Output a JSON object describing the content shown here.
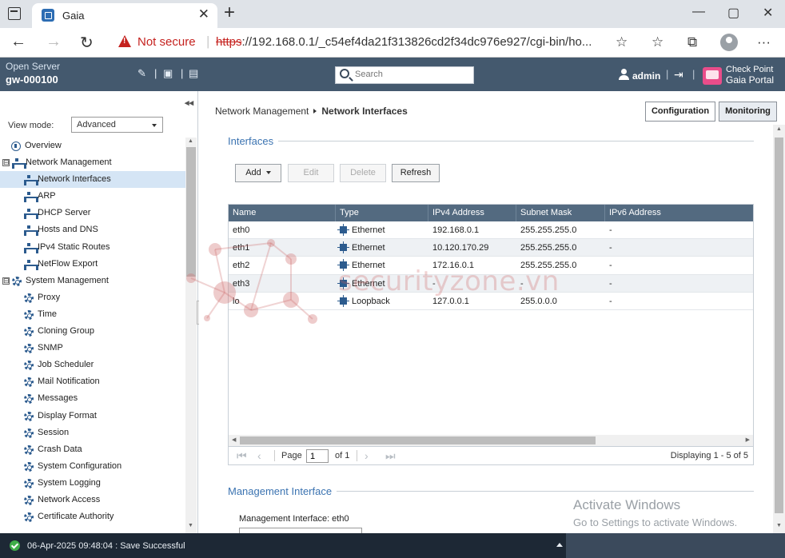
{
  "browser": {
    "tab_title": "Gaia",
    "new_tab_symbol": "+",
    "close_symbol": "✕",
    "window_buttons": [
      "—",
      "▢",
      "✕"
    ],
    "security_label": "Not secure",
    "url_scheme": "https",
    "url_rest": "://192.168.0.1/_c54ef4da21f313826cd2f34dc976e927/cgi-bin/ho..."
  },
  "header": {
    "product_label": "Open Server",
    "hostname": "gw-000100",
    "search_placeholder": "Search",
    "user": "admin",
    "brand_line1": "Check Point",
    "brand_line2": "Gaia Portal"
  },
  "sidebar": {
    "view_mode_label": "View mode:",
    "view_mode_value": "Advanced",
    "items": [
      {
        "label": "Overview",
        "icon": "overview-icon",
        "level": 0
      },
      {
        "label": "Network Management",
        "icon": "network-icon",
        "level": 0,
        "expander": "⊟"
      },
      {
        "label": "Network Interfaces",
        "icon": "network-icon",
        "level": 1,
        "selected": true
      },
      {
        "label": "ARP",
        "icon": "network-icon",
        "level": 1
      },
      {
        "label": "DHCP Server",
        "icon": "network-icon",
        "level": 1
      },
      {
        "label": "Hosts and DNS",
        "icon": "network-icon",
        "level": 1
      },
      {
        "label": "IPv4 Static Routes",
        "icon": "network-icon",
        "level": 1
      },
      {
        "label": "NetFlow Export",
        "icon": "network-icon",
        "level": 1
      },
      {
        "label": "System Management",
        "icon": "gear-icon",
        "level": 0,
        "expander": "⊟"
      },
      {
        "label": "Proxy",
        "icon": "gear-icon",
        "level": 1
      },
      {
        "label": "Time",
        "icon": "gear-icon",
        "level": 1
      },
      {
        "label": "Cloning Group",
        "icon": "gear-icon",
        "level": 1
      },
      {
        "label": "SNMP",
        "icon": "gear-icon",
        "level": 1
      },
      {
        "label": "Job Scheduler",
        "icon": "gear-icon",
        "level": 1
      },
      {
        "label": "Mail Notification",
        "icon": "gear-icon",
        "level": 1
      },
      {
        "label": "Messages",
        "icon": "gear-icon",
        "level": 1
      },
      {
        "label": "Display Format",
        "icon": "gear-icon",
        "level": 1
      },
      {
        "label": "Session",
        "icon": "gear-icon",
        "level": 1
      },
      {
        "label": "Crash Data",
        "icon": "gear-icon",
        "level": 1
      },
      {
        "label": "System Configuration",
        "icon": "gear-icon",
        "level": 1
      },
      {
        "label": "System Logging",
        "icon": "gear-icon",
        "level": 1
      },
      {
        "label": "Network Access",
        "icon": "gear-icon",
        "level": 1
      },
      {
        "label": "Certificate Authority",
        "icon": "gear-icon",
        "level": 1
      }
    ]
  },
  "main": {
    "breadcrumb_parent": "Network Management",
    "breadcrumb_current": "Network Interfaces",
    "configuration_label": "Configuration",
    "monitoring_label": "Monitoring",
    "interfaces_section": "Interfaces",
    "toolbar": {
      "add_label": "Add",
      "edit_label": "Edit",
      "delete_label": "Delete",
      "refresh_label": "Refresh"
    },
    "columns": [
      "Name",
      "Type",
      "IPv4 Address",
      "Subnet Mask",
      "IPv6 Address"
    ],
    "rows": [
      {
        "name": "eth0",
        "type": "Ethernet",
        "ipv4": "192.168.0.1",
        "mask": "255.255.255.0",
        "ipv6": "-"
      },
      {
        "name": "eth1",
        "type": "Ethernet",
        "ipv4": "10.120.170.29",
        "mask": "255.255.255.0",
        "ipv6": "-"
      },
      {
        "name": "eth2",
        "type": "Ethernet",
        "ipv4": "172.16.0.1",
        "mask": "255.255.255.0",
        "ipv6": "-"
      },
      {
        "name": "eth3",
        "type": "Ethernet",
        "ipv4": "-",
        "mask": "-",
        "ipv6": "-"
      },
      {
        "name": "lo",
        "type": "Loopback",
        "ipv4": "127.0.0.1",
        "mask": "255.0.0.0",
        "ipv6": "-"
      }
    ],
    "pager": {
      "page_label": "Page",
      "page_value": "1",
      "of_label": "of 1",
      "display_text": "Displaying 1 - 5 of 5"
    },
    "management_section": "Management Interface",
    "management_label": "Management Interface: eth0",
    "watermark": "securityzone.vn",
    "activate_title": "Activate Windows",
    "activate_sub": "Go to Settings to activate Windows."
  },
  "status": {
    "message": "06-Apr-2025 09:48:04 : Save Successful"
  },
  "colors": {
    "header_bg": "#44596e",
    "grid_header_bg": "#536a80",
    "section_title": "#3b73b1",
    "selected_nav": "#d5e5f5",
    "status_bg": "#1d2835",
    "danger": "#c5221f"
  }
}
